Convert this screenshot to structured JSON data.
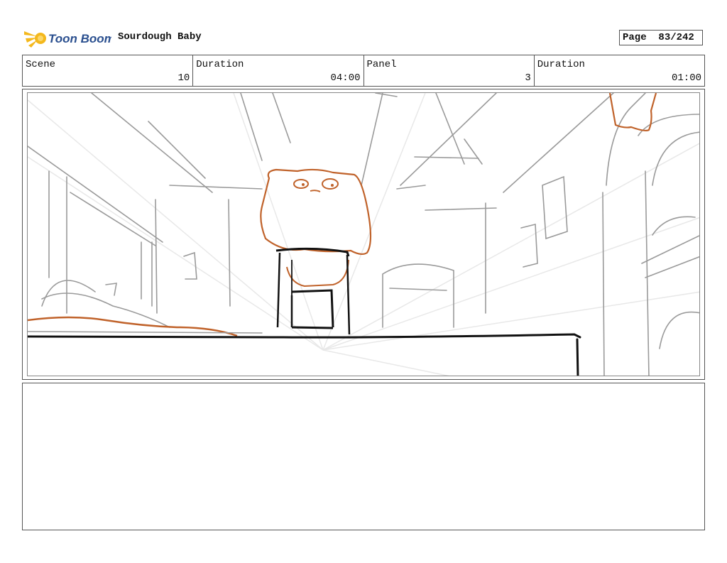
{
  "header": {
    "logo_text": "Toon Boom",
    "project_title": "Sourdough Baby",
    "page_label": "Page",
    "page_number": "83/242"
  },
  "info": {
    "scene_label": "Scene",
    "scene_value": "10",
    "scene_duration_label": "Duration",
    "scene_duration_value": "04:00",
    "panel_label": "Panel",
    "panel_value": "3",
    "panel_duration_label": "Duration",
    "panel_duration_value": "01:00"
  },
  "colors": {
    "logo_yellow": "#f4b81c",
    "logo_blue": "#2a4f8f",
    "character_orange": "#c0622a",
    "sketch_gray": "#9a9a9a",
    "sketch_black": "#111111"
  },
  "notes": {
    "text": ""
  }
}
